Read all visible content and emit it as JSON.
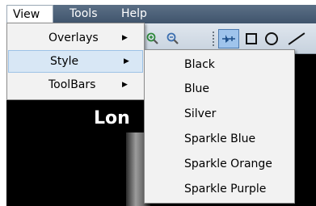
{
  "menubar": {
    "items": [
      {
        "label": "View"
      },
      {
        "label": "Tools"
      },
      {
        "label": "Help"
      }
    ]
  },
  "view_menu": {
    "items": [
      {
        "label": "Overlays",
        "has_submenu": true
      },
      {
        "label": "Style",
        "has_submenu": true,
        "highlighted": true
      },
      {
        "label": "ToolBars",
        "has_submenu": true
      }
    ]
  },
  "style_menu": {
    "items": [
      {
        "label": "Black"
      },
      {
        "label": "Blue"
      },
      {
        "label": "Silver"
      },
      {
        "label": "Sparkle Blue"
      },
      {
        "label": "Sparkle Orange"
      },
      {
        "label": "Sparkle Purple"
      }
    ]
  },
  "toolbar": {
    "icons": [
      "zoom-in-icon",
      "zoom-out-icon",
      "pointer-icon",
      "rectangle-icon",
      "circle-icon",
      "line-icon"
    ]
  },
  "content": {
    "title_fragment": "Lon"
  },
  "colors": {
    "menubar": "#4b6078",
    "toolbar": "#d5dde7",
    "menu_bg": "#f2f2f2",
    "highlight": "#d8e7f5",
    "pointer_active": "#9fc4ec",
    "content_bg": "#000000"
  }
}
